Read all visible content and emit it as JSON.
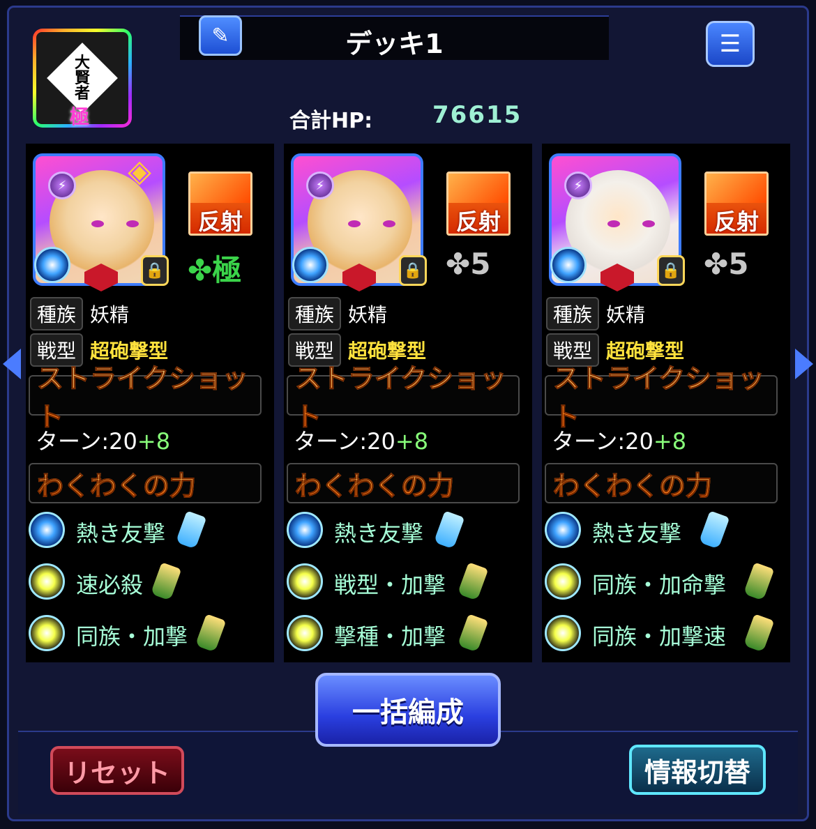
{
  "header": {
    "title": "デッキ1",
    "hp_label": "合計HP:",
    "hp_value": "76615",
    "badge": {
      "line1": "大",
      "line2": "賢",
      "line3": "者",
      "kanji": "極"
    }
  },
  "cards": [
    {
      "reflect_label": "反射",
      "luck": "✤極",
      "race_tag": "種族",
      "race": "妖精",
      "type_tag": "戦型",
      "type": "超砲撃型",
      "strike_shot": "ストライクショット",
      "turn_label": "ターン:20",
      "turn_bonus": "+8",
      "waku_title": "わくわくの力",
      "abilities": [
        "熱き友撃",
        "速必殺",
        "同族・加撃"
      ]
    },
    {
      "reflect_label": "反射",
      "luck": "✤5",
      "race_tag": "種族",
      "race": "妖精",
      "type_tag": "戦型",
      "type": "超砲撃型",
      "strike_shot": "ストライクショット",
      "turn_label": "ターン:20",
      "turn_bonus": "+8",
      "waku_title": "わくわくの力",
      "abilities": [
        "熱き友撃",
        "戦型・加撃",
        "撃種・加撃"
      ]
    },
    {
      "reflect_label": "反射",
      "luck": "✤5",
      "race_tag": "種族",
      "race": "妖精",
      "type_tag": "戦型",
      "type": "超砲撃型",
      "strike_shot": "ストライクショット",
      "turn_label": "ターン:20",
      "turn_bonus": "+8",
      "waku_title": "わくわくの力",
      "abilities": [
        "熱き友撃",
        "同族・加命撃",
        "同族・加撃速"
      ]
    }
  ],
  "buttons": {
    "bulk": "一括編成",
    "reset": "リセット",
    "info": "情報切替",
    "edit_icon": "✎",
    "menu_icon": "☰"
  },
  "colors": {
    "accent": "#2b3a8c",
    "hp": "#9ff0d4",
    "ability_text": "#a7ffd8",
    "type": "#ffe23d"
  }
}
